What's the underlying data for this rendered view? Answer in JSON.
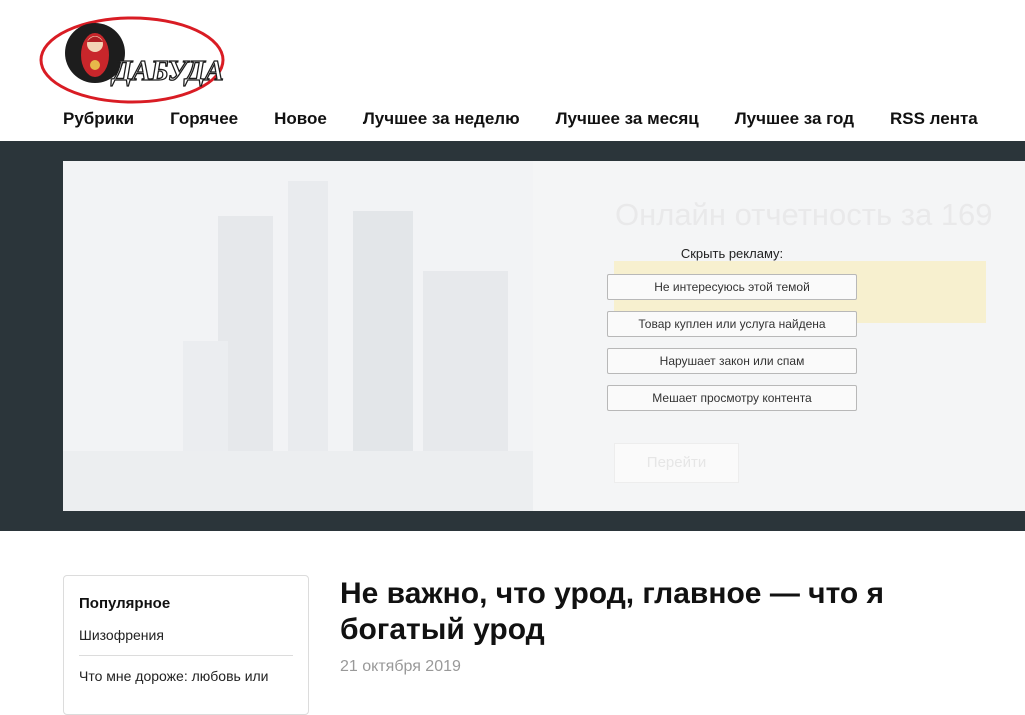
{
  "logo": {
    "text": "ДАБУДА",
    "accent": "#d91c24"
  },
  "nav": {
    "items": [
      {
        "label": "Рубрики"
      },
      {
        "label": "Горячее"
      },
      {
        "label": "Новое"
      },
      {
        "label": "Лучшее за неделю"
      },
      {
        "label": "Лучшее за месяц"
      },
      {
        "label": "Лучшее за год"
      },
      {
        "label": "RSS лента"
      }
    ]
  },
  "ad": {
    "headline_faded": "Онлайн отчетность за 169",
    "hide_title": "Скрыть рекламу:",
    "hide_options": [
      {
        "label": "Не интересуюсь этой темой"
      },
      {
        "label": "Товар куплен или услуга найдена"
      },
      {
        "label": "Нарушает закон или спам"
      },
      {
        "label": "Мешает просмотру контента"
      }
    ],
    "cta_faded": "Перейти"
  },
  "sidebar": {
    "title": "Популярное",
    "items": [
      {
        "label": "Шизофрения"
      },
      {
        "label": "Что мне дороже: любовь или"
      }
    ]
  },
  "article": {
    "title": "Не важно, что урод, главное — что я богатый урод",
    "date": "21 октября 2019"
  }
}
